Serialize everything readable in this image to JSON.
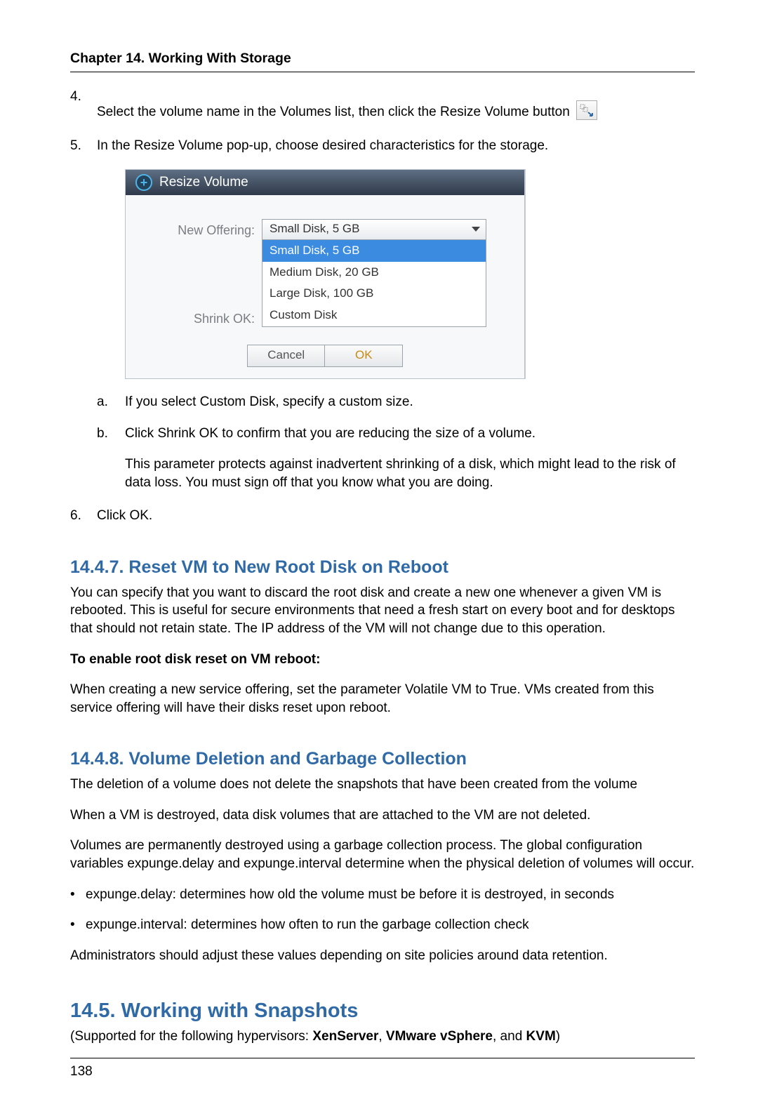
{
  "chapter_header": "Chapter 14. Working With Storage",
  "items": {
    "i4_num": "4.",
    "i4_text_a": "Select the volume name in the Volumes list, then click the Resize Volume button",
    "i5_num": "5.",
    "i5_text": "In the Resize Volume pop-up, choose desired characteristics for the storage.",
    "i5a_num": "a.",
    "i5a_text": "If you select Custom Disk, specify a custom size.",
    "i5b_num": "b.",
    "i5b_text": "Click Shrink OK to confirm that you are reducing the size of a volume.",
    "i5b_para": "This parameter protects against inadvertent shrinking of a disk, which might lead to the risk of data loss. You must sign off that you know what you are doing.",
    "i6_num": "6.",
    "i6_text": "Click OK."
  },
  "dialog": {
    "title": "Resize Volume",
    "label_offering": "New Offering:",
    "label_shrink": "Shrink OK:",
    "selected": "Small Disk, 5 GB",
    "options": {
      "o0": "Small Disk, 5 GB",
      "o1": "Medium Disk, 20 GB",
      "o2": "Large Disk, 100 GB",
      "o3": "Custom Disk"
    },
    "cancel": "Cancel",
    "ok": "OK"
  },
  "sec1447": {
    "title": "14.4.7. Reset VM to New Root Disk on Reboot",
    "p1": "You can specify that you want to discard the root disk and create a new one whenever a given VM is rebooted. This is useful for secure environments that need a fresh start on every boot and for desktops that should not retain state. The IP address of the VM will not change due to this operation.",
    "sub": "To enable root disk reset on VM reboot:",
    "p2": "When creating a new service offering, set the parameter Volatile VM to True. VMs created from this service offering will have their disks reset upon reboot."
  },
  "sec1448": {
    "title": "14.4.8. Volume Deletion and Garbage Collection",
    "p1": "The deletion of a volume does not delete the snapshots that have been created from the volume",
    "p2": "When a VM is destroyed, data disk volumes that are attached to the VM are not deleted.",
    "p3": "Volumes are permanently destroyed using a garbage collection process. The global configuration variables expunge.delay and expunge.interval determine when the physical deletion of volumes will occur.",
    "b1": "expunge.delay: determines how old the volume must be before it is destroyed, in seconds",
    "b2": "expunge.interval: determines how often to run the garbage collection check",
    "p4": "Administrators should adjust these values depending on site policies around data retention."
  },
  "sec145": {
    "title": "14.5. Working with Snapshots",
    "p1a": "(Supported for the following hypervisors: ",
    "hv1": "XenServer",
    "sep1": ", ",
    "hv2": "VMware vSphere",
    "sep2": ", and ",
    "hv3": "KVM",
    "p1b": ")"
  },
  "page_number": "138"
}
